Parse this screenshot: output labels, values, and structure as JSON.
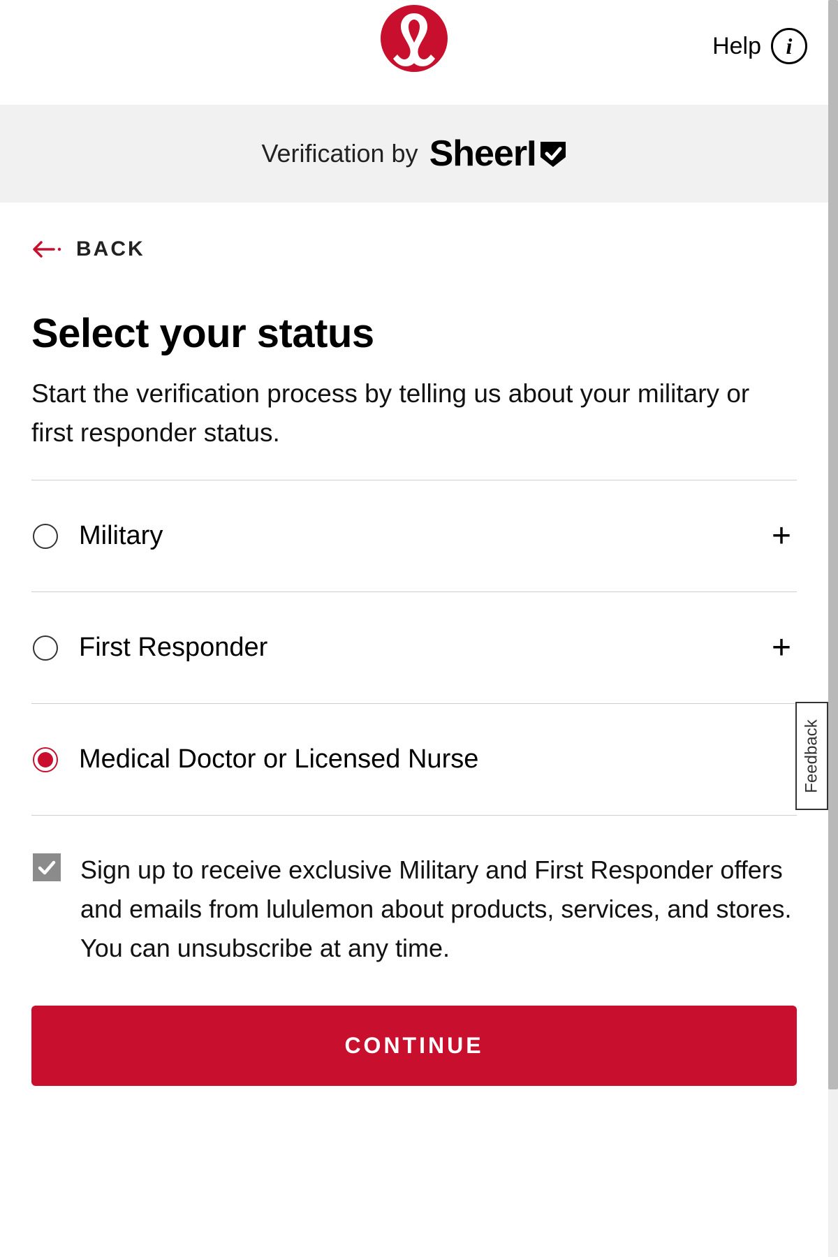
{
  "header": {
    "help_label": "Help",
    "info_glyph": "i"
  },
  "verification": {
    "prefix": "Verification by",
    "brand_main": "Sheer",
    "brand_i": "I"
  },
  "nav": {
    "back_label": "BACK"
  },
  "page": {
    "title": "Select your status",
    "subtitle": "Start the verification process by telling us about your military or first responder status."
  },
  "options": [
    {
      "label": "Military",
      "selected": false,
      "expandable": true
    },
    {
      "label": "First Responder",
      "selected": false,
      "expandable": true
    },
    {
      "label": "Medical Doctor or Licensed Nurse",
      "selected": true,
      "expandable": false
    }
  ],
  "signup": {
    "checked": true,
    "text": "Sign up to receive exclusive Military and First Responder offers and emails from lululemon about products, services, and stores. You can unsubscribe at any time."
  },
  "cta": {
    "continue": "CONTINUE"
  },
  "feedback": {
    "label": "Feedback"
  },
  "glyphs": {
    "plus": "+"
  }
}
